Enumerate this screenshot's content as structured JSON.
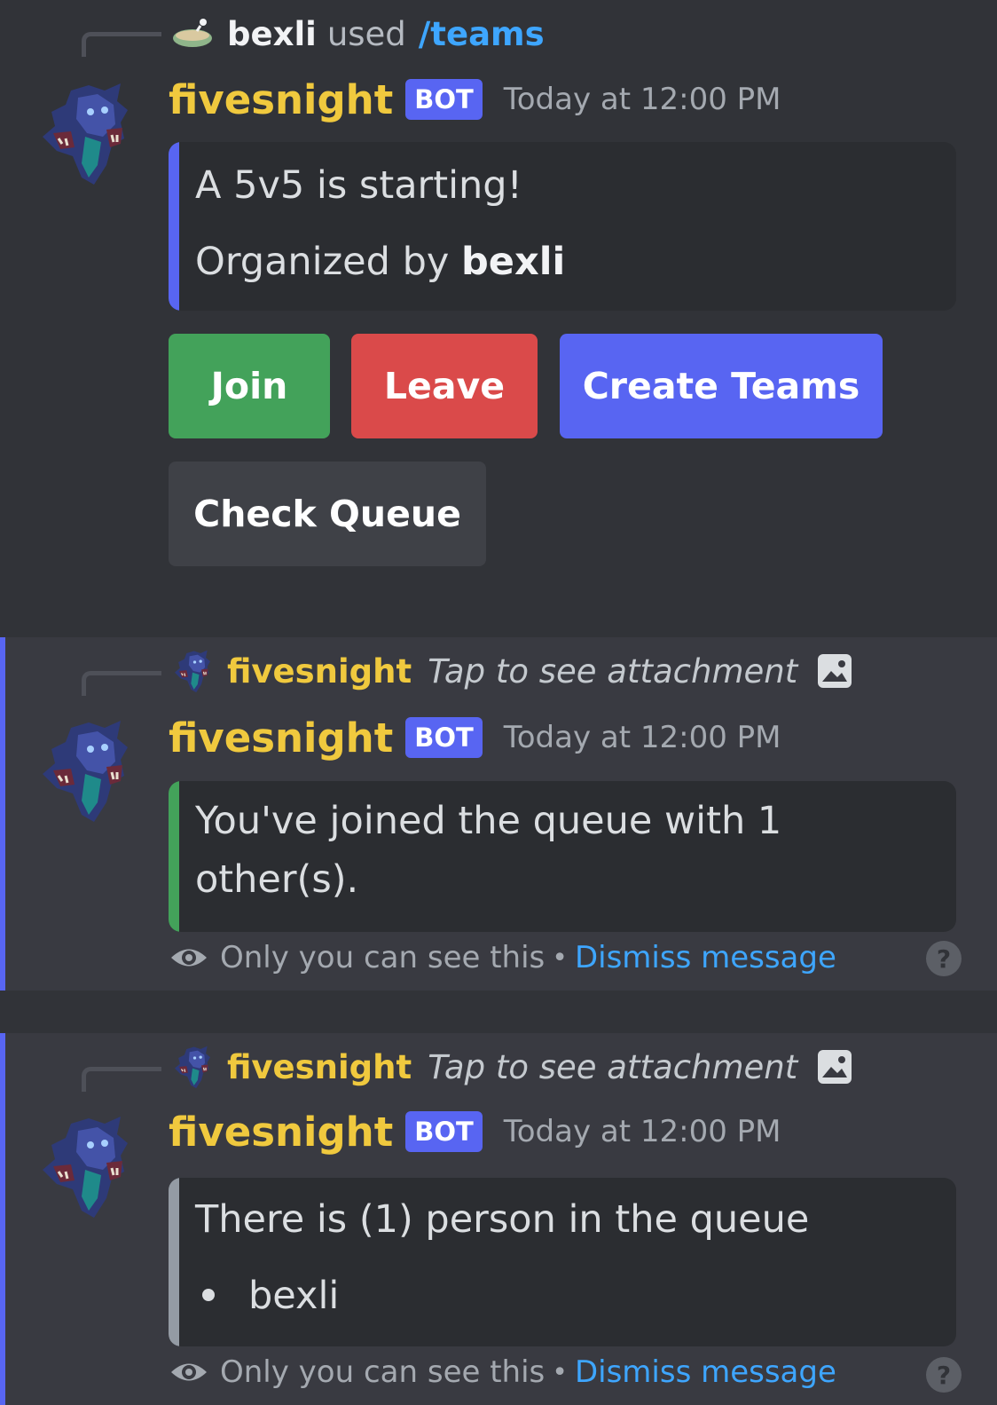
{
  "messages": [
    {
      "reply": {
        "user": "bexli",
        "used": "used",
        "command": "/teams"
      },
      "author": "fivesnight",
      "bot_tag": "BOT",
      "timestamp": "Today at 12:00 PM",
      "embed": {
        "line1": "A 5v5 is starting!",
        "line2_prefix": "Organized by",
        "line2_bold": "bexli",
        "accent": "#5865f2"
      },
      "buttons": {
        "join": "Join",
        "leave": "Leave",
        "create_teams": "Create Teams",
        "check_queue": "Check Queue"
      }
    },
    {
      "reply": {
        "user": "fivesnight",
        "attachment_text": "Tap to see attachment"
      },
      "author": "fivesnight",
      "bot_tag": "BOT",
      "timestamp": "Today at 12:00 PM",
      "embed": {
        "line1": "You've joined the queue with 1",
        "line2": "other(s).",
        "accent": "#43a25a"
      },
      "footer": {
        "only_you": "Only you can see this",
        "separator": "•",
        "dismiss": "Dismiss message",
        "help": "?"
      }
    },
    {
      "reply": {
        "user": "fivesnight",
        "attachment_text": "Tap to see attachment"
      },
      "author": "fivesnight",
      "bot_tag": "BOT",
      "timestamp": "Today at 12:00 PM",
      "embed": {
        "line1": "There is (1) person in the queue",
        "list": [
          "bexli"
        ],
        "accent": "#949ba4"
      },
      "footer": {
        "only_you": "Only you can see this",
        "separator": "•",
        "dismiss": "Dismiss message",
        "help": "?"
      }
    }
  ],
  "icons": {
    "reply_user_icon": "bowl-icon",
    "avatar": "dragon-avatar",
    "image": "image-icon",
    "eye": "eye-icon",
    "help": "help-icon"
  },
  "colors": {
    "background": "#313338",
    "ephemeral_background": "#393a41",
    "author": "#f0c93e",
    "link": "#3ea6ff"
  }
}
